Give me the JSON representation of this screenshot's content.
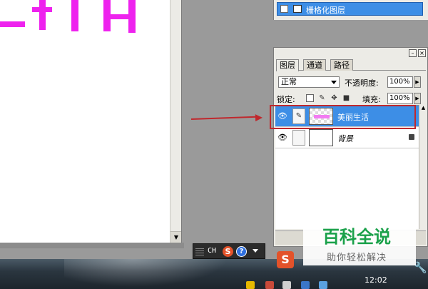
{
  "history": {
    "item_label": "栅格化图层"
  },
  "layers_panel": {
    "tabs": [
      "图层",
      "通道",
      "路径"
    ],
    "blend_mode": "正常",
    "opacity_label": "不透明度:",
    "opacity_value": "100%",
    "lock_label": "锁定:",
    "fill_label": "填充:",
    "fill_value": "100%",
    "layers": [
      {
        "name": "美丽生活",
        "selected": true
      },
      {
        "name": "背景",
        "selected": false,
        "locked": true
      }
    ]
  },
  "ime_bar": {
    "mode": "CH"
  },
  "taskbar": {
    "clock": "12:02"
  },
  "watermark": {
    "title": "百科全说",
    "subtitle": "助你轻松解决"
  },
  "colors": {
    "accent": "#3d8ee6",
    "annotation": "#c0282d",
    "canvas_text": "#ee22ee",
    "watermark_green": "#1aa14a"
  }
}
